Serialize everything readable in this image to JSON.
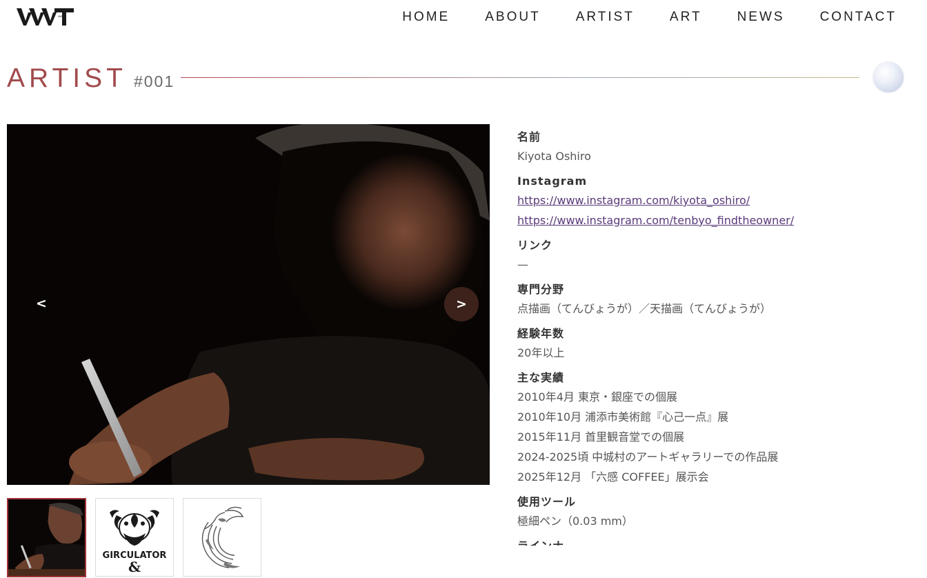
{
  "header": {
    "logo_text": "WAT",
    "nav": [
      "HOME",
      "ABOUT",
      "ARTIST",
      "ART",
      "NEWS",
      "CONTACT"
    ]
  },
  "title": {
    "main": "ARTIST",
    "number": "#001"
  },
  "gallery": {
    "prev_label": "<",
    "next_label": ">",
    "thumbnail_caption": "GIRCULATOR"
  },
  "profile": {
    "name_label": "名前",
    "name": "Kiyota Oshiro",
    "instagram_label": "Instagram",
    "instagram_links": [
      "https://www.instagram.com/kiyota_oshiro/",
      "https://www.instagram.com/tenbyo_findtheowner/"
    ],
    "link_label": "リンク",
    "link_value": "—",
    "field_label": "専門分野",
    "field_value": "点描画（てんびょうが）／天描画（てんびょうが）",
    "years_label": "経験年数",
    "years_value": "20年以上",
    "achievements_label": "主な実績",
    "achievements": [
      "2010年4月 東京・銀座での個展",
      "2010年10月 浦添市美術館『心己一点』展",
      "2015年11月 首里観音堂での個展",
      "2024-2025頃 中城村のアートギャラリーでの作品展",
      "2025年12月 「六感 COFFEE」展示会"
    ],
    "tools_label": "使用ツール",
    "tools_value": "極細ペン（0.03 mm）",
    "next_label": "ラインナ"
  },
  "colors": {
    "accent": "#a24a4c",
    "link": "#5a3a7a",
    "text": "#3a3a3a"
  }
}
